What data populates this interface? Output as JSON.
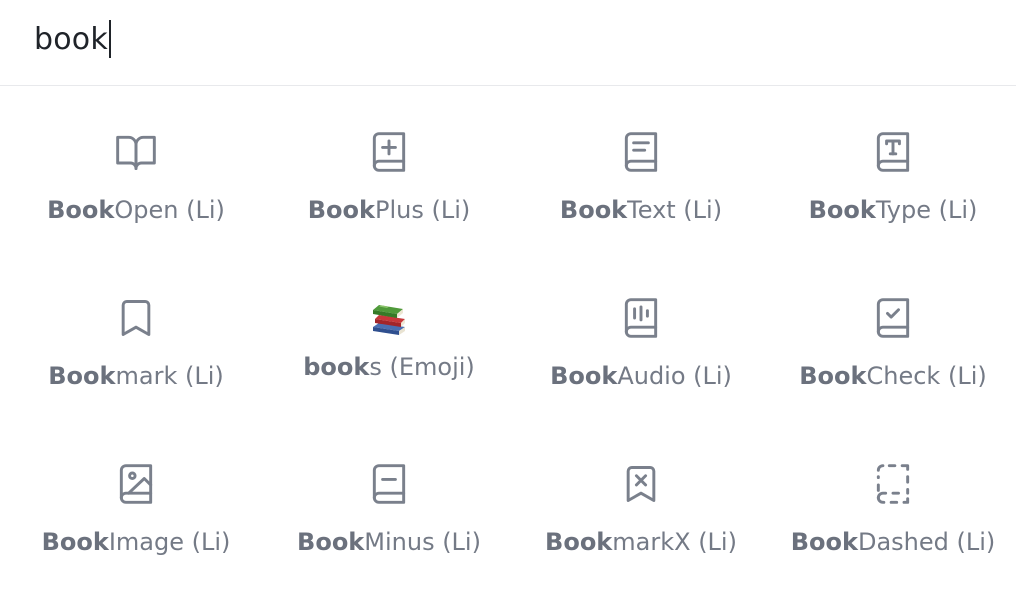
{
  "search": {
    "value": "book"
  },
  "results": [
    {
      "match": "Book",
      "rest": "Open (Li)",
      "icon": "book-open-icon"
    },
    {
      "match": "Book",
      "rest": "Plus (Li)",
      "icon": "book-plus-icon"
    },
    {
      "match": "Book",
      "rest": "Text (Li)",
      "icon": "book-text-icon"
    },
    {
      "match": "Book",
      "rest": "Type (Li)",
      "icon": "book-type-icon"
    },
    {
      "match": "Book",
      "rest": "mark (Li)",
      "icon": "bookmark-icon"
    },
    {
      "match": "book",
      "rest": "s (Emoji)",
      "icon": "books-emoji-icon"
    },
    {
      "match": "Book",
      "rest": "Audio (Li)",
      "icon": "book-audio-icon"
    },
    {
      "match": "Book",
      "rest": "Check (Li)",
      "icon": "book-check-icon"
    },
    {
      "match": "Book",
      "rest": "Image (Li)",
      "icon": "book-image-icon"
    },
    {
      "match": "Book",
      "rest": "Minus (Li)",
      "icon": "book-minus-icon"
    },
    {
      "match": "Book",
      "rest": "markX (Li)",
      "icon": "bookmark-x-icon"
    },
    {
      "match": "Book",
      "rest": "Dashed (Li)",
      "icon": "book-dashed-icon"
    }
  ],
  "colors": {
    "icon": "#7a808c",
    "text": "#747a86",
    "input_text": "#1f2329",
    "divider": "#e8e9ec"
  }
}
